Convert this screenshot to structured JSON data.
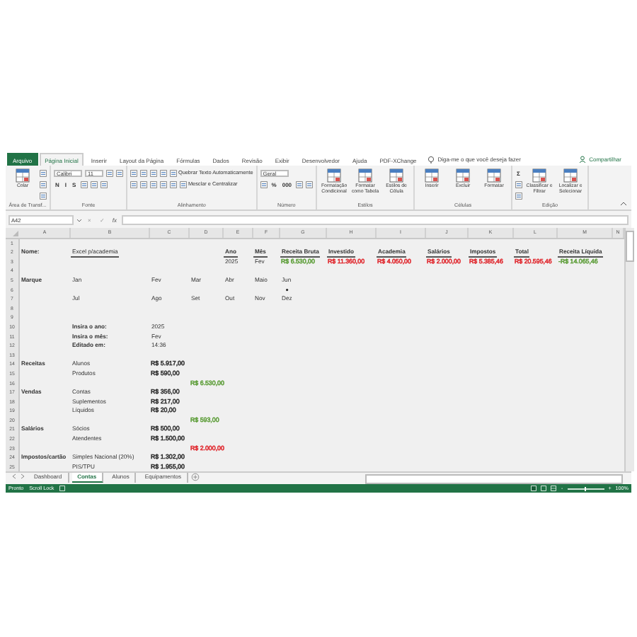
{
  "ribbon_tabs": [
    {
      "label": "Arquivo",
      "kind": "file",
      "selected": false
    },
    {
      "label": "Página Inicial",
      "kind": "tab",
      "selected": true
    },
    {
      "label": "Inserir",
      "kind": "tab",
      "selected": false
    },
    {
      "label": "Layout da Página",
      "kind": "tab",
      "selected": false
    },
    {
      "label": "Fórmulas",
      "kind": "tab",
      "selected": false
    },
    {
      "label": "Dados",
      "kind": "tab",
      "selected": false
    },
    {
      "label": "Revisão",
      "kind": "tab",
      "selected": false
    },
    {
      "label": "Exibir",
      "kind": "tab",
      "selected": false
    },
    {
      "label": "Desenvolvedor",
      "kind": "tab",
      "selected": false
    },
    {
      "label": "Ajuda",
      "kind": "tab",
      "selected": false
    },
    {
      "label": "PDF-XChange",
      "kind": "tab",
      "selected": false
    }
  ],
  "tell_me": {
    "placeholder": "Diga-me o que você deseja fazer"
  },
  "share_button": {
    "label": "Compartilhar"
  },
  "ribbon_groups": [
    {
      "label": "Área de Transf...",
      "items": [
        {
          "kind": "large",
          "label": "Colar"
        },
        {
          "kind": "stack",
          "rows": [
            {
              "controls": [
                {
                  "kind": "icon"
                }
              ]
            },
            {
              "controls": [
                {
                  "kind": "icon"
                }
              ]
            },
            {
              "controls": [
                {
                  "kind": "icon"
                }
              ]
            }
          ]
        }
      ]
    },
    {
      "label": "Fonte",
      "items": [
        {
          "kind": "stack",
          "rows": [
            {
              "controls": [
                {
                  "kind": "combo",
                  "value": "Calibri"
                },
                {
                  "kind": "combo",
                  "value": "11"
                },
                {
                  "kind": "icon"
                },
                {
                  "kind": "icon"
                }
              ]
            },
            {
              "controls": [
                {
                  "kind": "text",
                  "label": "N"
                },
                {
                  "kind": "text",
                  "label": "I"
                },
                {
                  "kind": "text",
                  "label": "S"
                },
                {
                  "kind": "icon"
                },
                {
                  "kind": "icon"
                },
                {
                  "kind": "icon"
                }
              ]
            }
          ]
        }
      ]
    },
    {
      "label": "Alinhamento",
      "items": [
        {
          "kind": "stack",
          "rows": [
            {
              "controls": [
                {
                  "kind": "icon"
                },
                {
                  "kind": "icon"
                },
                {
                  "kind": "icon"
                },
                {
                  "kind": "icon"
                },
                {
                  "kind": "wide",
                  "label": "Quebrar Texto Automaticamente"
                }
              ]
            },
            {
              "controls": [
                {
                  "kind": "icon"
                },
                {
                  "kind": "icon"
                },
                {
                  "kind": "icon"
                },
                {
                  "kind": "icon"
                },
                {
                  "kind": "icon"
                },
                {
                  "kind": "wide",
                  "label": "Mesclar e Centralizar"
                }
              ]
            }
          ]
        }
      ]
    },
    {
      "label": "Número",
      "items": [
        {
          "kind": "stack",
          "rows": [
            {
              "controls": [
                {
                  "kind": "combo",
                  "value": "Geral"
                }
              ]
            },
            {
              "controls": [
                {
                  "kind": "icon"
                },
                {
                  "kind": "text",
                  "label": "%"
                },
                {
                  "kind": "text",
                  "label": "000"
                },
                {
                  "kind": "icon"
                },
                {
                  "kind": "icon"
                }
              ]
            }
          ]
        }
      ]
    },
    {
      "label": "Estilos",
      "items": [
        {
          "kind": "large",
          "label": "Formatação Condicional"
        },
        {
          "kind": "large",
          "label": "Formatar como Tabela"
        },
        {
          "kind": "large",
          "label": "Estilos de Célula"
        }
      ]
    },
    {
      "label": "Células",
      "items": [
        {
          "kind": "large",
          "label": "Inserir"
        },
        {
          "kind": "large",
          "label": "Excluir"
        },
        {
          "kind": "large",
          "label": "Formatar"
        }
      ]
    },
    {
      "label": "Edição",
      "items": [
        {
          "kind": "stack",
          "rows": [
            {
              "controls": [
                {
                  "kind": "text",
                  "label": "Σ"
                }
              ]
            },
            {
              "controls": [
                {
                  "kind": "icon"
                }
              ]
            },
            {
              "controls": [
                {
                  "kind": "icon"
                }
              ]
            }
          ]
        },
        {
          "kind": "large",
          "label": "Classificar e Filtrar"
        },
        {
          "kind": "large",
          "label": "Localizar e Selecionar"
        }
      ]
    }
  ],
  "formula_bar": {
    "name_box": "A42",
    "cancel": "×",
    "enter": "✓",
    "function": "fx"
  },
  "columns": [
    "A",
    "B",
    "C",
    "D",
    "E",
    "F",
    "G",
    "H",
    "I",
    "J",
    "K",
    "L",
    "M",
    "N"
  ],
  "rows": [
    {
      "number": "1"
    },
    {
      "number": "2",
      "cells": {
        "A": {
          "kind": "text",
          "text": "Nome:",
          "bold": true
        },
        "B": {
          "kind": "text",
          "text": "Excel p/academia",
          "bold": false,
          "underline": true
        },
        "E": {
          "kind": "text",
          "text": "Ano",
          "bold": true,
          "underline": true
        },
        "F": {
          "kind": "text",
          "text": "Mês",
          "bold": true,
          "underline": true
        },
        "G": {
          "kind": "text",
          "text": "Receita Bruta",
          "bold": true,
          "underline": true
        },
        "H": {
          "kind": "text",
          "text": "Investido",
          "bold": true,
          "underline": true
        },
        "I": {
          "kind": "text",
          "text": "Academia",
          "bold": true,
          "underline": true
        },
        "J": {
          "kind": "text",
          "text": "Salários",
          "bold": true,
          "underline": true
        },
        "K": {
          "kind": "text",
          "text": "Impostos",
          "bold": true,
          "underline": true
        },
        "L": {
          "kind": "text",
          "text": "Total",
          "bold": true,
          "underline": true
        },
        "M": {
          "kind": "text",
          "text": "Receita Líquida",
          "bold": true,
          "underline": true
        }
      }
    },
    {
      "number": "3",
      "cells": {
        "E": {
          "kind": "text",
          "text": "2025",
          "bold": false
        },
        "F": {
          "kind": "text",
          "text": "Fev",
          "bold": false
        },
        "G": {
          "kind": "money",
          "text": "R$ 6.530,00",
          "color": "#5e9e3a"
        },
        "H": {
          "kind": "money",
          "text": "R$ 11.360,00",
          "color": "#e0282e"
        },
        "I": {
          "kind": "money",
          "text": "R$ 4.050,00",
          "color": "#e0282e"
        },
        "J": {
          "kind": "money",
          "text": "R$ 2.000,00",
          "color": "#e0282e"
        },
        "K": {
          "kind": "money",
          "text": "R$ 5.385,46",
          "color": "#e0282e"
        },
        "L": {
          "kind": "money",
          "text": "R$ 20.595,46",
          "color": "#e0282e"
        },
        "M": {
          "kind": "money",
          "text": "-R$ 14.065,46",
          "color": "#5e9e3a"
        }
      }
    },
    {
      "number": "4"
    },
    {
      "number": "5",
      "cells": {
        "A": {
          "kind": "text",
          "text": "Marque",
          "bold": true
        },
        "B": {
          "kind": "text",
          "text": "Jan",
          "bold": false
        },
        "C": {
          "kind": "text",
          "text": "Fev",
          "bold": false
        },
        "D": {
          "kind": "text",
          "text": "Mar",
          "bold": false
        },
        "E": {
          "kind": "text",
          "text": "Abr",
          "bold": false
        },
        "F": {
          "kind": "text",
          "text": "Maio",
          "bold": false
        },
        "G": {
          "kind": "text",
          "text": "Jun",
          "bold": false
        }
      }
    },
    {
      "number": "6",
      "cells": {
        "G": {
          "kind": "dot"
        }
      }
    },
    {
      "number": "7",
      "cells": {
        "B": {
          "kind": "text",
          "text": "Jul",
          "bold": false
        },
        "C": {
          "kind": "text",
          "text": "Ago",
          "bold": false
        },
        "D": {
          "kind": "text",
          "text": "Set",
          "bold": false
        },
        "E": {
          "kind": "text",
          "text": "Out",
          "bold": false
        },
        "F": {
          "kind": "text",
          "text": "Nov",
          "bold": false
        },
        "G": {
          "kind": "text",
          "text": "Dez",
          "bold": false
        }
      }
    },
    {
      "number": "8"
    },
    {
      "number": "9"
    },
    {
      "number": "10",
      "cells": {
        "B": {
          "kind": "text",
          "text": "Insira o ano:",
          "bold": true
        },
        "C": {
          "kind": "text",
          "text": "2025",
          "bold": false
        }
      }
    },
    {
      "number": "11",
      "cells": {
        "B": {
          "kind": "text",
          "text": "Insira o mês:",
          "bold": true
        },
        "C": {
          "kind": "text",
          "text": "Fev",
          "bold": false
        }
      }
    },
    {
      "number": "12",
      "cells": {
        "B": {
          "kind": "text",
          "text": "Editado em:",
          "bold": true
        },
        "C": {
          "kind": "text",
          "text": "14:36",
          "bold": false
        }
      }
    },
    {
      "number": "13"
    },
    {
      "number": "14",
      "cells": {
        "A": {
          "kind": "text",
          "text": "Receitas",
          "bold": true
        },
        "B": {
          "kind": "text",
          "text": "Alunos",
          "bold": false
        },
        "C": {
          "kind": "money",
          "text": "R$ 5.917,00"
        }
      }
    },
    {
      "number": "15",
      "cells": {
        "B": {
          "kind": "text",
          "text": "Produtos",
          "bold": false
        },
        "C": {
          "kind": "money",
          "text": "R$ 590,00"
        }
      }
    },
    {
      "number": "16",
      "cells": {
        "D": {
          "kind": "money",
          "text": "R$ 6.530,00",
          "color": "#5e9e3a"
        }
      }
    },
    {
      "number": "17",
      "cells": {
        "A": {
          "kind": "text",
          "text": "Vendas",
          "bold": true
        },
        "B": {
          "kind": "text",
          "text": "Contas",
          "bold": false
        },
        "C": {
          "kind": "money",
          "text": "R$ 356,00"
        }
      }
    },
    {
      "number": "18",
      "cells": {
        "B": {
          "kind": "text",
          "text": "Suplementos",
          "bold": false
        },
        "C": {
          "kind": "money",
          "text": "R$ 217,00"
        }
      }
    },
    {
      "number": "19",
      "cells": {
        "B": {
          "kind": "text",
          "text": "Líquidos",
          "bold": false
        },
        "C": {
          "kind": "money",
          "text": "R$ 20,00"
        }
      }
    },
    {
      "number": "20",
      "cells": {
        "D": {
          "kind": "money",
          "text": "R$ 593,00",
          "color": "#5e9e3a"
        }
      }
    },
    {
      "number": "21",
      "cells": {
        "A": {
          "kind": "text",
          "text": "Salários",
          "bold": true
        },
        "B": {
          "kind": "text",
          "text": "Sócios",
          "bold": false
        },
        "C": {
          "kind": "money",
          "text": "R$ 500,00"
        }
      }
    },
    {
      "number": "22",
      "cells": {
        "B": {
          "kind": "text",
          "text": "Atendentes",
          "bold": false
        },
        "C": {
          "kind": "money",
          "text": "R$ 1.500,00"
        }
      }
    },
    {
      "number": "23",
      "cells": {
        "D": {
          "kind": "money",
          "text": "R$ 2.000,00",
          "color": "#e0282e"
        }
      }
    },
    {
      "number": "24",
      "cells": {
        "A": {
          "kind": "text",
          "text": "Impostos/cartão",
          "bold": true
        },
        "B": {
          "kind": "text",
          "text": "Simples Nacional (20%)",
          "bold": false
        },
        "C": {
          "kind": "money",
          "text": "R$ 1.302,00"
        }
      }
    },
    {
      "number": "25",
      "cells": {
        "B": {
          "kind": "text",
          "text": "PIS/TPU",
          "bold": false
        },
        "C": {
          "kind": "money",
          "text": "R$ 1.955,00"
        }
      }
    }
  ],
  "sheet_tabs": [
    {
      "label": "Dashboard",
      "selected": false
    },
    {
      "label": "Contas",
      "selected": true
    },
    {
      "label": "Alunos",
      "selected": false
    },
    {
      "label": "Equipamentos",
      "selected": false
    }
  ],
  "status_bar": {
    "mode": "Pronto",
    "scroll_lock": "Scroll Lock",
    "zoom": {
      "minus": "-",
      "plus": "+",
      "level": 0.5,
      "reading": "100%"
    }
  }
}
